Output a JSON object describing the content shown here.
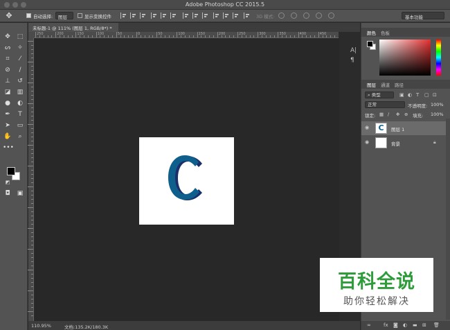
{
  "window": {
    "title": "Adobe Photoshop CC 2015.5"
  },
  "options_bar": {
    "auto_select_label": "自动选择:",
    "auto_select_value": "图层",
    "show_transform_label": "显示变换控件",
    "mode_3d_label": "3D 模式:",
    "workspace": "基本功能"
  },
  "document": {
    "tab_title": "未标题-1 @ 111% (图层 1, RGB/8*) *",
    "zoom": "110.95%",
    "doc_info": "文档:135.2K/180.3K",
    "ruler_labels": [
      "250",
      "200",
      "150",
      "100",
      "50",
      "0",
      "50",
      "100",
      "150",
      "200",
      "250",
      "300",
      "350",
      "400",
      "450"
    ]
  },
  "colors": {
    "foreground": "#000000",
    "background": "#ffffff",
    "letter_fill": "#0f5f8c",
    "letter_side": "#1a2f6b"
  },
  "panels": {
    "color_tabs": [
      "颜色",
      "色板"
    ],
    "layer_tabs": [
      "图层",
      "通道",
      "路径"
    ],
    "filter_kind": "类型",
    "blend_mode": "正常",
    "opacity_label": "不透明度:",
    "opacity_value": "100%",
    "lock_label": "锁定:",
    "fill_label": "填充:",
    "fill_value": "100%",
    "layers": [
      {
        "name": "图层 1",
        "thumb_glyph": "C"
      },
      {
        "name": "背景"
      }
    ]
  },
  "watermark": {
    "title": "百科全说",
    "subtitle": "助你轻松解决"
  }
}
